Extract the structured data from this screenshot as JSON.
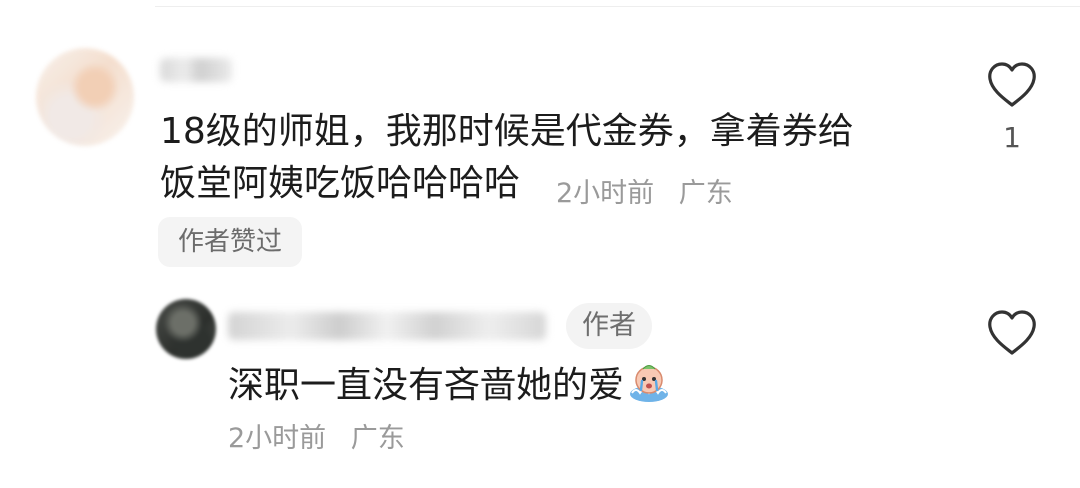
{
  "comment": {
    "text_line1": "18级的师姐，我那时候是代金券，拿着券给",
    "text_line2": "饭堂阿姨吃饭哈哈哈哈",
    "time": "2小时前",
    "location": "广东",
    "author_liked": "作者赞过",
    "like_count": "1",
    "like_icon": "heart-outline-icon"
  },
  "reply": {
    "author_badge": "作者",
    "text": "深职一直没有吝啬她的爱",
    "emoji": "crying-face-sticker",
    "time": "2小时前",
    "location": "广东",
    "like_icon": "heart-outline-icon"
  },
  "colors": {
    "text_primary": "#1c1c1c",
    "text_meta": "#9a9a9a",
    "pill_background": "#f4f4f4",
    "icon_stroke": "#333333"
  }
}
